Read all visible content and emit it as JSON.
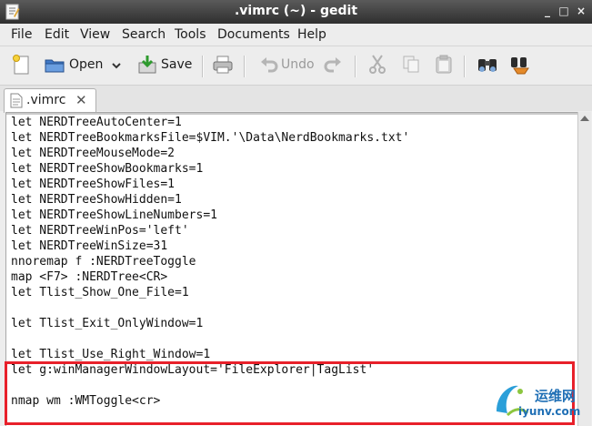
{
  "window": {
    "title": ".vimrc (~) - gedit",
    "controls": {
      "minimize": "_",
      "maximize": "□",
      "close": "×"
    }
  },
  "menubar": {
    "items": [
      "File",
      "Edit",
      "View",
      "Search",
      "Tools",
      "Documents",
      "Help"
    ]
  },
  "toolbar": {
    "new_icon": "new-document-icon",
    "open_label": "Open",
    "save_label": "Save",
    "undo_label": "Undo",
    "icons": [
      "new-document-icon",
      "open-folder-icon",
      "chevron-down-icon",
      "save-icon",
      "print-icon",
      "undo-icon",
      "redo-icon",
      "cut-icon",
      "copy-icon",
      "paste-icon",
      "find-icon",
      "find-replace-icon"
    ]
  },
  "tabs": [
    {
      "label": ".vimrc",
      "close": "✕"
    }
  ],
  "editor": {
    "lines": [
      "let NERDTreeAutoCenter=1",
      "let NERDTreeBookmarksFile=$VIM.'\\Data\\NerdBookmarks.txt'",
      "let NERDTreeMouseMode=2",
      "let NERDTreeShowBookmarks=1",
      "let NERDTreeShowFiles=1",
      "let NERDTreeShowHidden=1",
      "let NERDTreeShowLineNumbers=1",
      "let NERDTreeWinPos='left'",
      "let NERDTreeWinSize=31",
      "nnoremap f :NERDTreeToggle",
      "map <F7> :NERDTree<CR>",
      "let Tlist_Show_One_File=1",
      "",
      "let Tlist_Exit_OnlyWindow=1",
      "",
      "let Tlist_Use_Right_Window=1",
      "let g:winManagerWindowLayout='FileExplorer|TagList'",
      "",
      "nmap wm :WMToggle<cr>"
    ]
  },
  "colors": {
    "highlight_box": "#e8202a",
    "watermark": "#1f6fb5"
  },
  "watermark": {
    "text_cn": "运维网",
    "url": "iyunv.com"
  }
}
